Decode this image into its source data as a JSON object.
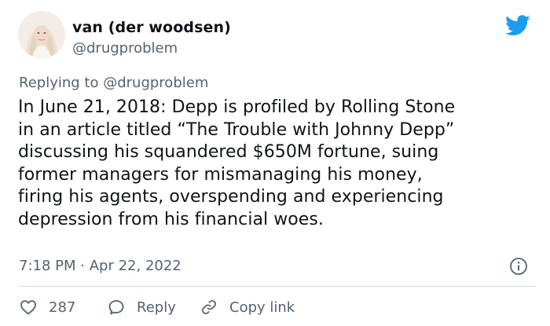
{
  "author": {
    "name": "van (der woodsen)",
    "handle": "@drugproblem",
    "avatar_icon": "profile-photo"
  },
  "platform_icon": "twitter-bird-icon",
  "reply_context": {
    "prefix": "Replying to",
    "mention": "@drugproblem"
  },
  "tweet": {
    "lines": [
      "In June 21, 2018: Depp is profiled by Rolling Stone",
      "in an article titled “The Trouble with Johnny Depp”",
      "discussing his squandered $650M fortune, suing",
      "former managers for mismanaging his money,",
      "firing his agents, overspending and experiencing",
      "depression from his financial woes."
    ]
  },
  "meta": {
    "time": "7:18 PM",
    "separator": "·",
    "date": "Apr 22, 2022"
  },
  "actions": {
    "likes_count": "287",
    "reply_label": "Reply",
    "copy_link_label": "Copy link"
  },
  "colors": {
    "accent": "#1d9bf0",
    "text": "#0f1419",
    "secondary": "#536471",
    "divider": "#cfd9de"
  }
}
